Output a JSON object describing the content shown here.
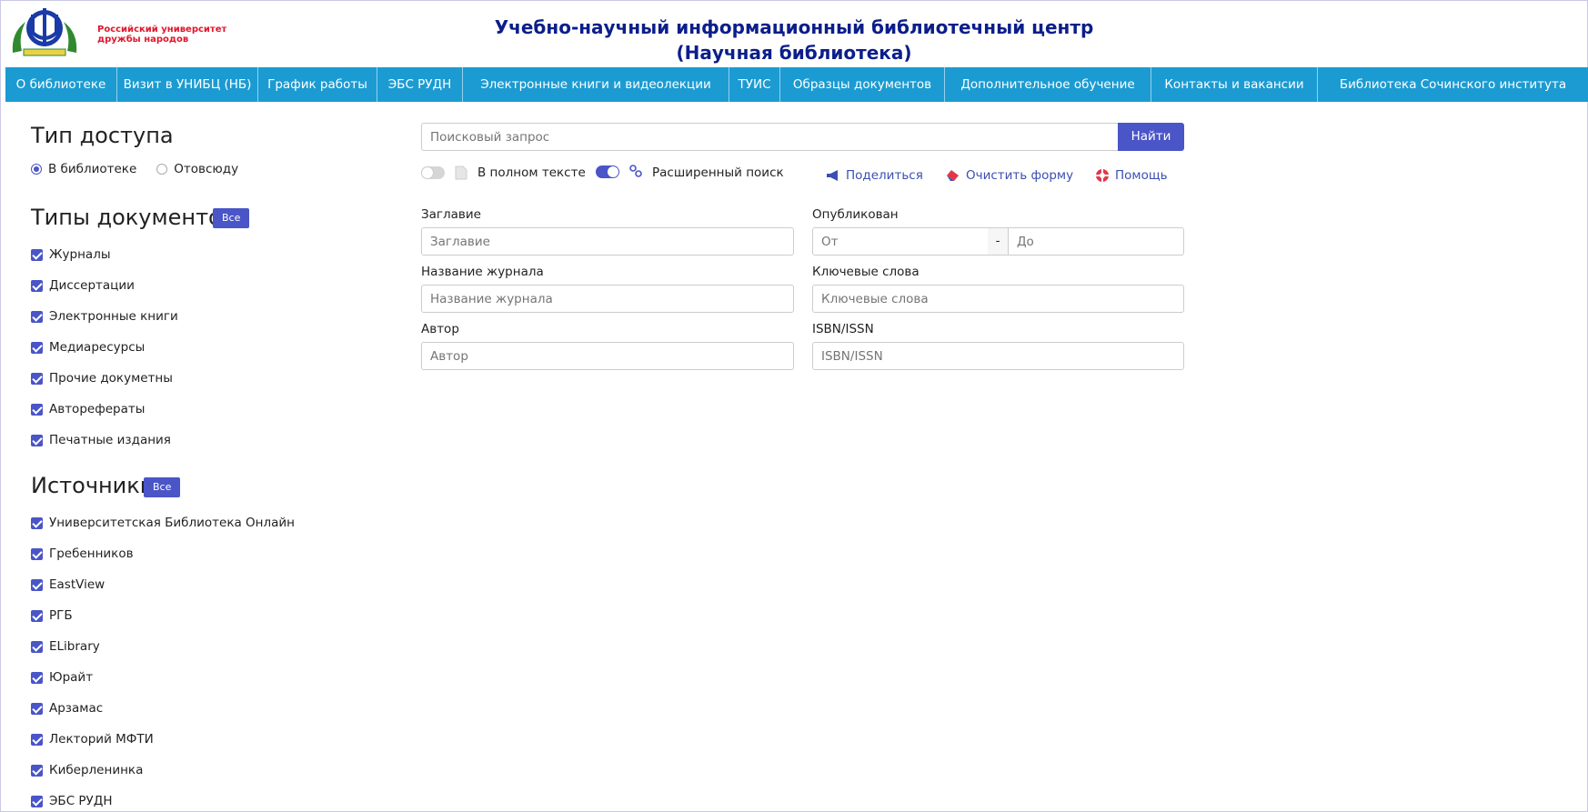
{
  "header": {
    "logo_text_line1": "Российский университет",
    "logo_text_line2": "дружбы народов",
    "title_line1": "Учебно-научный информационный библиотечный центр",
    "title_line2": "(Научная библиотека)"
  },
  "nav": [
    "О библиотеке",
    "Визит в УНИБЦ (НБ)",
    "График работы",
    "ЭБС РУДН",
    "Электронные книги и видеолекции",
    "ТУИС",
    "Образцы документов",
    "Дополнительное обучение",
    "Контакты и вакансии",
    "Библиотека Сочинского института"
  ],
  "access": {
    "heading": "Тип доступа",
    "options": [
      "В библиотеке",
      "Отовсюду"
    ],
    "selected": "В библиотеке"
  },
  "doc_types": {
    "heading": "Типы документов",
    "all_label": "Все",
    "items": [
      "Журналы",
      "Диссертации",
      "Электронные книги",
      "Медиаресурсы",
      "Прочие докуметны",
      "Авторефераты",
      "Печатные издания"
    ]
  },
  "sources": {
    "heading": "Источники",
    "all_label": "Все",
    "items": [
      "Университетская Библиотека Онлайн",
      "Гребенников",
      "EastView",
      "РГБ",
      "ELibrary",
      "Юрайт",
      "Арзамас",
      "Лекторий МФТИ",
      "Киберленинка",
      "ЭБС РУДН"
    ]
  },
  "search": {
    "placeholder": "Поисковый запрос",
    "button": "Найти",
    "full_text_label": "В полном тексте",
    "full_text_on": false,
    "advanced_label": "Расширенный поиск",
    "advanced_on": true,
    "share": "Поделиться",
    "clear": "Очистить форму",
    "help": "Помощь"
  },
  "fields": {
    "title_label": "Заглавие",
    "title_placeholder": "Заглавие",
    "published_label": "Опубликован",
    "from_placeholder": "От",
    "dash": "-",
    "to_placeholder": "До",
    "journal_label": "Название журнала",
    "journal_placeholder": "Название журнала",
    "keywords_label": "Ключевые слова",
    "keywords_placeholder": "Ключевые слова",
    "author_label": "Автор",
    "author_placeholder": "Автор",
    "isbn_label": "ISBN/ISSN",
    "isbn_placeholder": "ISBN/ISSN"
  },
  "colors": {
    "accent": "#4a55c7",
    "nav": "#1b9bd2",
    "title": "#0b1e8a",
    "link": "#3a4fb4"
  }
}
